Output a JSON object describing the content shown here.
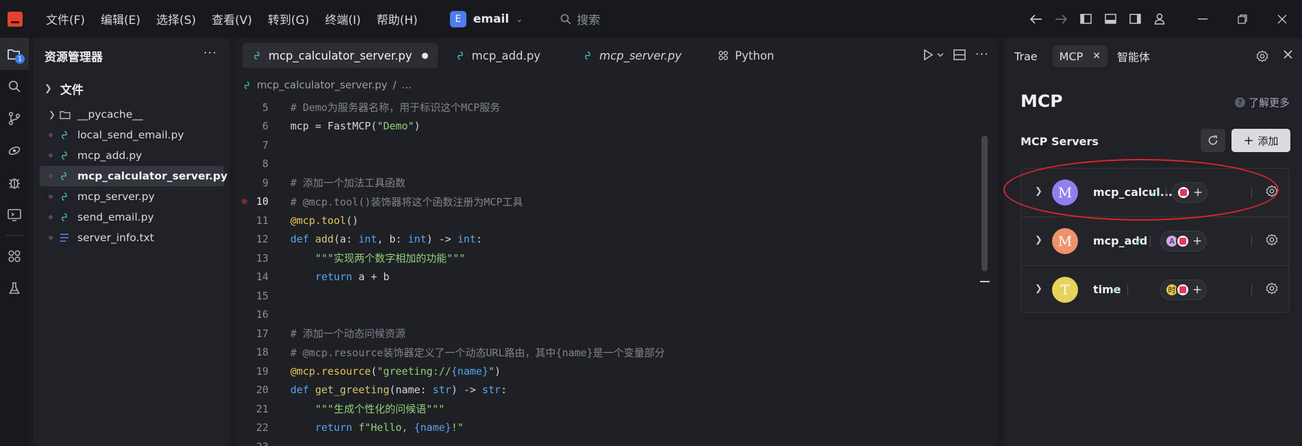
{
  "menu": [
    "文件(F)",
    "编辑(E)",
    "选择(S)",
    "查看(V)",
    "转到(G)",
    "终端(I)",
    "帮助(H)"
  ],
  "project": {
    "badge": "E",
    "name": "email"
  },
  "search": {
    "placeholder": "搜索"
  },
  "activity_badge": "1",
  "explorer": {
    "title": "资源管理器",
    "more": "···",
    "section": "文件",
    "items": [
      {
        "label": "__pycache__",
        "type": "folder"
      },
      {
        "label": "local_send_email.py",
        "type": "py"
      },
      {
        "label": "mcp_add.py",
        "type": "py"
      },
      {
        "label": "mcp_calculator_server.py",
        "type": "py",
        "selected": true
      },
      {
        "label": "mcp_server.py",
        "type": "py"
      },
      {
        "label": "send_email.py",
        "type": "py"
      },
      {
        "label": "server_info.txt",
        "type": "txt"
      }
    ]
  },
  "editor": {
    "tabs": [
      {
        "label": "mcp_calculator_server.py",
        "active": true,
        "modified": true
      },
      {
        "label": "mcp_add.py"
      },
      {
        "label": "mcp_server.py",
        "italic": true
      },
      {
        "label": "Python",
        "grid": true
      }
    ],
    "breadcrumb": {
      "file": "mcp_calculator_server.py",
      "rest": "..."
    },
    "lines": [
      {
        "n": "5",
        "html": "<span class='cm'># Demo为服务器名称，用于标识这个MCP服务</span>"
      },
      {
        "n": "6",
        "html": "mcp = FastMCP(<span class='st'>\"Demo\"</span>)"
      },
      {
        "n": "7",
        "html": ""
      },
      {
        "n": "8",
        "html": ""
      },
      {
        "n": "9",
        "html": "<span class='cm'># 添加一个加法工具函数</span>"
      },
      {
        "n": "10",
        "html": "<span class='cm'># @mcp.tool()装饰器将这个函数注册为MCP工具</span>",
        "cur": true,
        "bp": true
      },
      {
        "n": "11",
        "html": "<span class='dec'>@mcp.tool</span>()"
      },
      {
        "n": "12",
        "html": "<span class='kw'>def</span> <span class='fn'>add</span>(a: <span class='tp'>int</span>, b: <span class='tp'>int</span>) -> <span class='tp'>int</span>:"
      },
      {
        "n": "13",
        "html": "    <span class='st'>\"\"\"实现两个数字相加的功能\"\"\"</span>"
      },
      {
        "n": "14",
        "html": "    <span class='kw'>return</span> a + b"
      },
      {
        "n": "15",
        "html": ""
      },
      {
        "n": "16",
        "html": ""
      },
      {
        "n": "17",
        "html": "<span class='cm'># 添加一个动态问候资源</span>"
      },
      {
        "n": "18",
        "html": "<span class='cm'># @mcp.resource装饰器定义了一个动态URL路由，其中{name}是一个变量部分</span>"
      },
      {
        "n": "19",
        "html": "<span class='dec'>@mcp.resource</span>(<span class='st'>\"greeting://</span><span class='kw'>{name}</span><span class='st'>\"</span>)"
      },
      {
        "n": "20",
        "html": "<span class='kw'>def</span> <span class='fn'>get_greeting</span>(name: <span class='tp'>str</span>) -> <span class='tp'>str</span>:"
      },
      {
        "n": "21",
        "html": "    <span class='st'>\"\"\"生成个性化的问候语\"\"\"</span>"
      },
      {
        "n": "22",
        "html": "    <span class='kw'>return</span> <span class='st'>f\"Hello, </span><span class='kw'>{name}</span><span class='st'>!\"</span>"
      },
      {
        "n": "23",
        "html": ""
      }
    ]
  },
  "mcp_panel": {
    "tabs": [
      "Trae",
      "MCP",
      "智能体"
    ],
    "title": "MCP",
    "learn_more": "了解更多",
    "servers_label": "MCP Servers",
    "add_label": "添加",
    "servers": [
      {
        "letter": "M",
        "name": "mcp_calcul...",
        "color": "#8f7ff0",
        "agents": [
          "red"
        ]
      },
      {
        "letter": "M",
        "name": "mcp_add",
        "color": "#f0916b",
        "agents": [
          "A",
          "red"
        ]
      },
      {
        "letter": "T",
        "name": "time",
        "color": "#e7d35a",
        "agents": [
          "时",
          "red"
        ]
      }
    ]
  },
  "colors": {
    "accent": "#3d7df0",
    "annotation": "#e0262b",
    "ok": "#4cc38a"
  }
}
